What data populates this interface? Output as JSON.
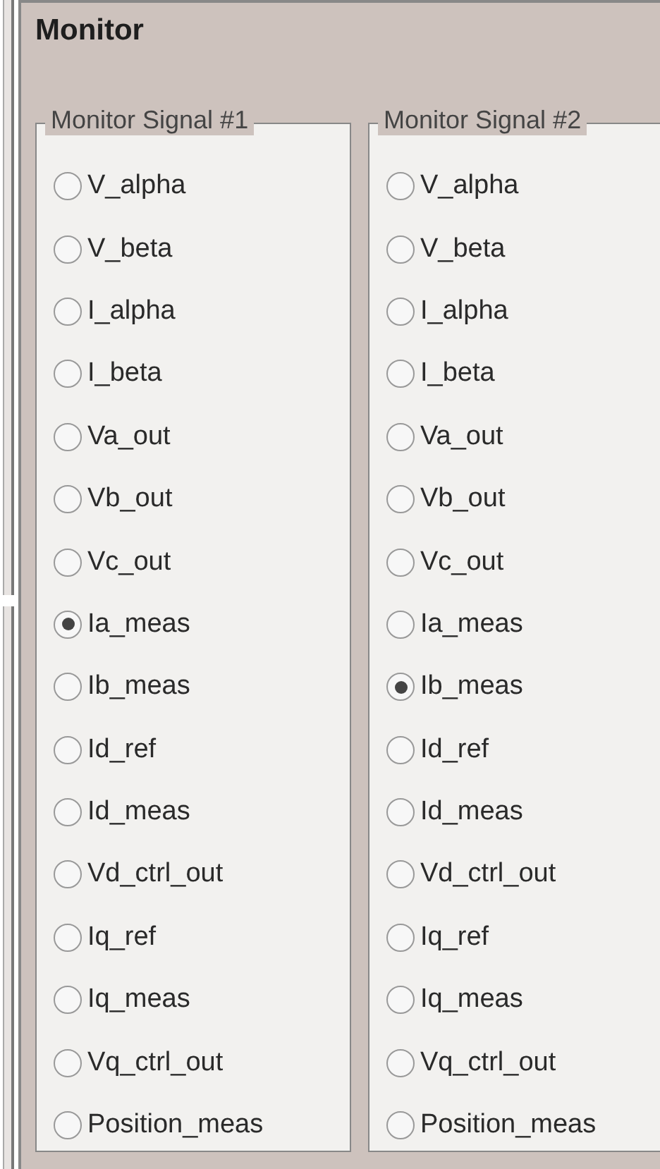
{
  "panel": {
    "title": "Monitor"
  },
  "groups": [
    {
      "title": "Monitor Signal #1",
      "options": [
        {
          "label": "V_alpha",
          "selected": false
        },
        {
          "label": "V_beta",
          "selected": false
        },
        {
          "label": "I_alpha",
          "selected": false
        },
        {
          "label": "I_beta",
          "selected": false
        },
        {
          "label": "Va_out",
          "selected": false
        },
        {
          "label": "Vb_out",
          "selected": false
        },
        {
          "label": "Vc_out",
          "selected": false
        },
        {
          "label": "Ia_meas",
          "selected": true
        },
        {
          "label": "Ib_meas",
          "selected": false
        },
        {
          "label": "Id_ref",
          "selected": false
        },
        {
          "label": "Id_meas",
          "selected": false
        },
        {
          "label": "Vd_ctrl_out",
          "selected": false
        },
        {
          "label": "Iq_ref",
          "selected": false
        },
        {
          "label": "Iq_meas",
          "selected": false
        },
        {
          "label": "Vq_ctrl_out",
          "selected": false
        },
        {
          "label": "Position_meas",
          "selected": false
        }
      ]
    },
    {
      "title": "Monitor Signal #2",
      "options": [
        {
          "label": "V_alpha",
          "selected": false
        },
        {
          "label": "V_beta",
          "selected": false
        },
        {
          "label": "I_alpha",
          "selected": false
        },
        {
          "label": "I_beta",
          "selected": false
        },
        {
          "label": "Va_out",
          "selected": false
        },
        {
          "label": "Vb_out",
          "selected": false
        },
        {
          "label": "Vc_out",
          "selected": false
        },
        {
          "label": "Ia_meas",
          "selected": false
        },
        {
          "label": "Ib_meas",
          "selected": true
        },
        {
          "label": "Id_ref",
          "selected": false
        },
        {
          "label": "Id_meas",
          "selected": false
        },
        {
          "label": "Vd_ctrl_out",
          "selected": false
        },
        {
          "label": "Iq_ref",
          "selected": false
        },
        {
          "label": "Iq_meas",
          "selected": false
        },
        {
          "label": "Vq_ctrl_out",
          "selected": false
        },
        {
          "label": "Position_meas",
          "selected": false
        }
      ]
    }
  ]
}
